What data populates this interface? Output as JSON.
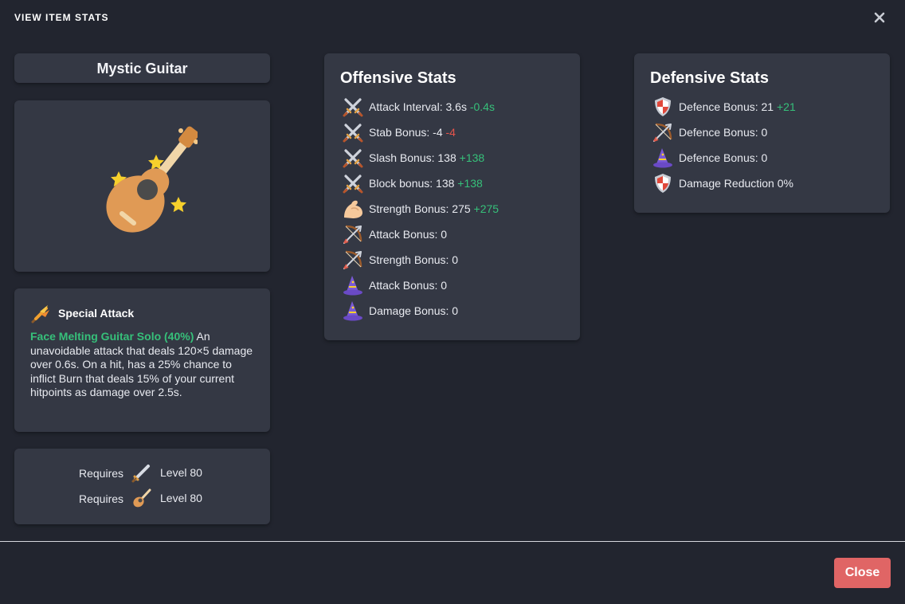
{
  "modal": {
    "title": "VIEW ITEM STATS"
  },
  "item": {
    "name": "Mystic Guitar"
  },
  "special_attack": {
    "title": "Special Attack",
    "name": "Face Melting Guitar Solo (40%)",
    "description": "An unavoidable attack that deals 120×5 damage over 0.6s. On a hit, has a 25% chance to inflict Burn that deals 15% of your current hitpoints as damage over 2.5s."
  },
  "requirements": [
    {
      "label": "Requires",
      "icon": "sword-icon",
      "level": "Level 80"
    },
    {
      "label": "Requires",
      "icon": "guitar-icon",
      "level": "Level 80"
    }
  ],
  "offensive": {
    "title": "Offensive Stats",
    "stats": [
      {
        "icon": "crossed-swords-icon",
        "label": "Attack Interval: 3.6s",
        "delta": "-0.4s",
        "delta_color": "#36c07a"
      },
      {
        "icon": "crossed-swords-icon",
        "label": "Stab Bonus: -4",
        "delta": "-4",
        "delta_color": "#e5534b"
      },
      {
        "icon": "crossed-swords-icon",
        "label": "Slash Bonus: 138",
        "delta": "+138",
        "delta_color": "#36c07a"
      },
      {
        "icon": "crossed-swords-icon",
        "label": "Block bonus: 138",
        "delta": "+138",
        "delta_color": "#36c07a"
      },
      {
        "icon": "flexed-bicep-icon",
        "label": "Strength Bonus: 275",
        "delta": "+275",
        "delta_color": "#36c07a"
      },
      {
        "icon": "bow-and-arrow-icon",
        "label": "Attack Bonus: 0",
        "delta": "",
        "delta_color": ""
      },
      {
        "icon": "bow-and-arrow-icon",
        "label": "Strength Bonus: 0",
        "delta": "",
        "delta_color": ""
      },
      {
        "icon": "wizard-hat-icon",
        "label": "Attack Bonus: 0",
        "delta": "",
        "delta_color": ""
      },
      {
        "icon": "wizard-hat-icon",
        "label": "Damage Bonus: 0",
        "delta": "",
        "delta_color": ""
      }
    ]
  },
  "defensive": {
    "title": "Defensive Stats",
    "stats": [
      {
        "icon": "shield-icon",
        "label": "Defence Bonus: 21",
        "delta": "+21",
        "delta_color": "#36c07a"
      },
      {
        "icon": "bow-and-arrow-icon",
        "label": "Defence Bonus: 0",
        "delta": "",
        "delta_color": ""
      },
      {
        "icon": "wizard-hat-icon",
        "label": "Defence Bonus: 0",
        "delta": "",
        "delta_color": ""
      },
      {
        "icon": "shield-icon",
        "label": "Damage Reduction 0%",
        "delta": "",
        "delta_color": ""
      }
    ]
  },
  "footer": {
    "close_label": "Close"
  },
  "colors": {
    "background": "#22252f",
    "card": "#343844",
    "positive": "#36c07a",
    "negative": "#e5534b",
    "close_button": "#e06565"
  }
}
